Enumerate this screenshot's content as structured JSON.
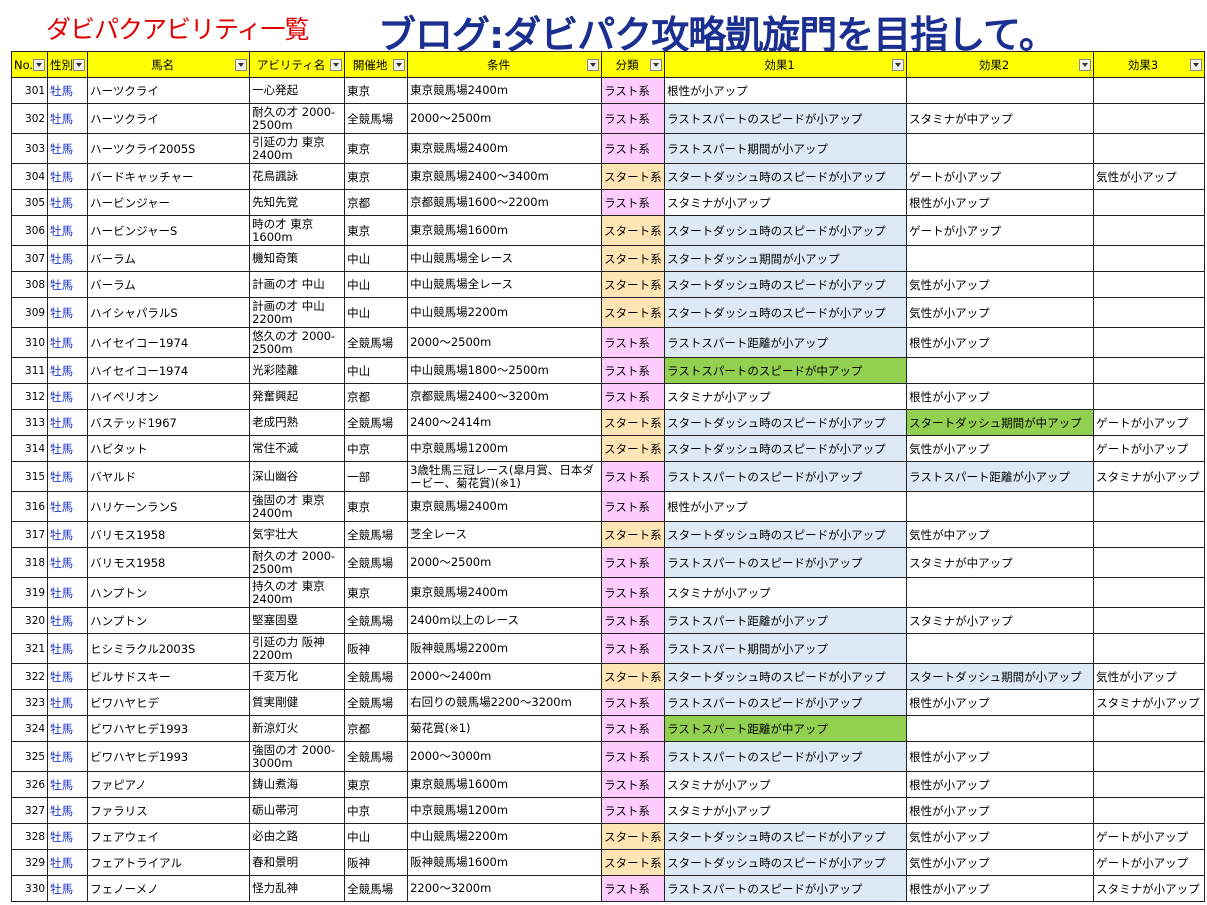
{
  "header": {
    "title_left": "ダビパクアビリティ一覧",
    "title_right": "ブログ:ダビパク攻略凱旋門を目指して。"
  },
  "columns": [
    "No.",
    "性別",
    "馬名",
    "アビリティ名",
    "開催地",
    "条件",
    "分類",
    "効果1",
    "効果2",
    "効果3"
  ],
  "colors": {
    "header_bg": "#ffff00",
    "title_left": "#e00000",
    "title_right": "#1a2f8f",
    "category_last": "#ffccff",
    "category_start": "#ffe4b5",
    "effect_small": "#dde9f5",
    "effect_medium": "#92d050"
  },
  "rows": [
    {
      "no": "301",
      "sex": "牡馬",
      "name": "ハーツクライ",
      "ability": "一心発起",
      "venue": "東京",
      "cond": "東京競馬場2400m",
      "cat": "ラスト系",
      "e1": "根性が小アップ",
      "e2": "",
      "e3": ""
    },
    {
      "no": "302",
      "sex": "牡馬",
      "name": "ハーツクライ",
      "ability": "耐久の才 2000-2500m",
      "venue": "全競馬場",
      "cond": "2000～2500m",
      "cat": "ラスト系",
      "e1": "ラストスパートのスピードが小アップ",
      "e2": "スタミナが中アップ",
      "e3": ""
    },
    {
      "no": "303",
      "sex": "牡馬",
      "name": "ハーツクライ2005S",
      "ability": "引延の力 東京2400m",
      "venue": "東京",
      "cond": "東京競馬場2400m",
      "cat": "ラスト系",
      "e1": "ラストスパート期間が小アップ",
      "e2": "",
      "e3": ""
    },
    {
      "no": "304",
      "sex": "牡馬",
      "name": "バードキャッチャー",
      "ability": "花鳥諷詠",
      "venue": "東京",
      "cond": "東京競馬場2400～3400m",
      "cat": "スタート系",
      "e1": "スタートダッシュ時のスピードが小アップ",
      "e2": "ゲートが小アップ",
      "e3": "気性が小アップ"
    },
    {
      "no": "305",
      "sex": "牡馬",
      "name": "ハービンジャー",
      "ability": "先知先覚",
      "venue": "京都",
      "cond": "京都競馬場1600～2200m",
      "cat": "ラスト系",
      "e1": "スタミナが小アップ",
      "e2": "根性が小アップ",
      "e3": ""
    },
    {
      "no": "306",
      "sex": "牡馬",
      "name": "ハービンジャーS",
      "ability": "時の才 東京1600m",
      "venue": "東京",
      "cond": "東京競馬場1600m",
      "cat": "スタート系",
      "e1": "スタートダッシュ時のスピードが小アップ",
      "e2": "ゲートが小アップ",
      "e3": ""
    },
    {
      "no": "307",
      "sex": "牡馬",
      "name": "バーラム",
      "ability": "機知奇策",
      "venue": "中山",
      "cond": "中山競馬場全レース",
      "cat": "スタート系",
      "e1": "スタートダッシュ期間が小アップ",
      "e2": "",
      "e3": ""
    },
    {
      "no": "308",
      "sex": "牡馬",
      "name": "バーラム",
      "ability": "計画の才 中山",
      "venue": "中山",
      "cond": "中山競馬場全レース",
      "cat": "スタート系",
      "e1": "スタートダッシュ時のスピードが小アップ",
      "e2": "気性が小アップ",
      "e3": ""
    },
    {
      "no": "309",
      "sex": "牡馬",
      "name": "ハイシャパラルS",
      "ability": "計画の才 中山2200m",
      "venue": "中山",
      "cond": "中山競馬場2200m",
      "cat": "スタート系",
      "e1": "スタートダッシュ時のスピードが小アップ",
      "e2": "気性が小アップ",
      "e3": ""
    },
    {
      "no": "310",
      "sex": "牡馬",
      "name": "ハイセイコー1974",
      "ability": "悠久の才 2000-2500m",
      "venue": "全競馬場",
      "cond": "2000～2500m",
      "cat": "ラスト系",
      "e1": "ラストスパート距離が小アップ",
      "e2": "根性が小アップ",
      "e3": ""
    },
    {
      "no": "311",
      "sex": "牡馬",
      "name": "ハイセイコー1974",
      "ability": "光彩陸離",
      "venue": "中山",
      "cond": "中山競馬場1800～2500m",
      "cat": "ラスト系",
      "e1": "ラストスパートのスピードが中アップ",
      "e2": "",
      "e3": ""
    },
    {
      "no": "312",
      "sex": "牡馬",
      "name": "ハイペリオン",
      "ability": "発奮興起",
      "venue": "京都",
      "cond": "京都競馬場2400～3200m",
      "cat": "ラスト系",
      "e1": "スタミナが小アップ",
      "e2": "根性が小アップ",
      "e3": ""
    },
    {
      "no": "313",
      "sex": "牡馬",
      "name": "バステッド1967",
      "ability": "老成円熟",
      "venue": "全競馬場",
      "cond": "2400～2414m",
      "cat": "スタート系",
      "e1": "スタートダッシュ時のスピードが小アップ",
      "e2": "スタートダッシュ期間が中アップ",
      "e3": "ゲートが小アップ"
    },
    {
      "no": "314",
      "sex": "牡馬",
      "name": "ハビタット",
      "ability": "常住不滅",
      "venue": "中京",
      "cond": "中京競馬場1200m",
      "cat": "スタート系",
      "e1": "スタートダッシュ時のスピードが小アップ",
      "e2": "気性が小アップ",
      "e3": "ゲートが小アップ"
    },
    {
      "no": "315",
      "sex": "牡馬",
      "name": "バヤルド",
      "ability": "深山幽谷",
      "venue": "一部",
      "cond": "3歳牡馬三冠レース(皐月賞、日本ダービー、菊花賞)(※1)",
      "cat": "ラスト系",
      "e1": "ラストスパートのスピードが小アップ",
      "e2": "ラストスパート距離が小アップ",
      "e3": "スタミナが小アップ"
    },
    {
      "no": "316",
      "sex": "牡馬",
      "name": "ハリケーンランS",
      "ability": "強固の才 東京2400m",
      "venue": "東京",
      "cond": "東京競馬場2400m",
      "cat": "ラスト系",
      "e1": "根性が小アップ",
      "e2": "",
      "e3": ""
    },
    {
      "no": "317",
      "sex": "牡馬",
      "name": "バリモス1958",
      "ability": "気宇壮大",
      "venue": "全競馬場",
      "cond": "芝全レース",
      "cat": "スタート系",
      "e1": "スタートダッシュ時のスピードが小アップ",
      "e2": "気性が中アップ",
      "e3": ""
    },
    {
      "no": "318",
      "sex": "牡馬",
      "name": "バリモス1958",
      "ability": "耐久の才 2000-2500m",
      "venue": "全競馬場",
      "cond": "2000～2500m",
      "cat": "ラスト系",
      "e1": "ラストスパートのスピードが小アップ",
      "e2": "スタミナが中アップ",
      "e3": ""
    },
    {
      "no": "319",
      "sex": "牡馬",
      "name": "ハンプトン",
      "ability": "持久の才 東京2400m",
      "venue": "東京",
      "cond": "東京競馬場2400m",
      "cat": "ラスト系",
      "e1": "スタミナが小アップ",
      "e2": "",
      "e3": ""
    },
    {
      "no": "320",
      "sex": "牡馬",
      "name": "ハンプトン",
      "ability": "堅塞固塁",
      "venue": "全競馬場",
      "cond": "2400m以上のレース",
      "cat": "ラスト系",
      "e1": "ラストスパート距離が小アップ",
      "e2": "スタミナが小アップ",
      "e3": ""
    },
    {
      "no": "321",
      "sex": "牡馬",
      "name": "ヒシミラクル2003S",
      "ability": "引延の力 阪神2200m",
      "venue": "阪神",
      "cond": "阪神競馬場2200m",
      "cat": "ラスト系",
      "e1": "ラストスパート期間が小アップ",
      "e2": "",
      "e3": ""
    },
    {
      "no": "322",
      "sex": "牡馬",
      "name": "ビルサドスキー",
      "ability": "千変万化",
      "venue": "全競馬場",
      "cond": "2000～2400m",
      "cat": "スタート系",
      "e1": "スタートダッシュ時のスピードが小アップ",
      "e2": "スタートダッシュ期間が小アップ",
      "e3": "気性が小アップ"
    },
    {
      "no": "323",
      "sex": "牡馬",
      "name": "ビワハヤヒデ",
      "ability": "質実剛健",
      "venue": "全競馬場",
      "cond": "右回りの競馬場2200～3200m",
      "cat": "ラスト系",
      "e1": "ラストスパートのスピードが小アップ",
      "e2": "根性が小アップ",
      "e3": "スタミナが小アップ"
    },
    {
      "no": "324",
      "sex": "牡馬",
      "name": "ビワハヤヒデ1993",
      "ability": "新涼灯火",
      "venue": "京都",
      "cond": "菊花賞(※1)",
      "cat": "ラスト系",
      "e1": "ラストスパート距離が中アップ",
      "e2": "",
      "e3": ""
    },
    {
      "no": "325",
      "sex": "牡馬",
      "name": "ビワハヤヒデ1993",
      "ability": "強固の才 2000-3000m",
      "venue": "全競馬場",
      "cond": "2000～3000m",
      "cat": "ラスト系",
      "e1": "ラストスパートのスピードが小アップ",
      "e2": "根性が小アップ",
      "e3": ""
    },
    {
      "no": "326",
      "sex": "牡馬",
      "name": "ファピアノ",
      "ability": "鋳山煮海",
      "venue": "東京",
      "cond": "東京競馬場1600m",
      "cat": "ラスト系",
      "e1": "スタミナが小アップ",
      "e2": "根性が小アップ",
      "e3": ""
    },
    {
      "no": "327",
      "sex": "牡馬",
      "name": "ファラリス",
      "ability": "砺山帯河",
      "venue": "中京",
      "cond": "中京競馬場1200m",
      "cat": "ラスト系",
      "e1": "スタミナが小アップ",
      "e2": "根性が小アップ",
      "e3": ""
    },
    {
      "no": "328",
      "sex": "牡馬",
      "name": "フェアウェイ",
      "ability": "必由之路",
      "venue": "中山",
      "cond": "中山競馬場2200m",
      "cat": "スタート系",
      "e1": "スタートダッシュ時のスピードが小アップ",
      "e2": "気性が小アップ",
      "e3": "ゲートが小アップ"
    },
    {
      "no": "329",
      "sex": "牡馬",
      "name": "フェアトライアル",
      "ability": "春和景明",
      "venue": "阪神",
      "cond": "阪神競馬場1600m",
      "cat": "スタート系",
      "e1": "スタートダッシュ時のスピードが小アップ",
      "e2": "気性が小アップ",
      "e3": "ゲートが小アップ"
    },
    {
      "no": "330",
      "sex": "牡馬",
      "name": "フェノーメノ",
      "ability": "怪力乱神",
      "venue": "全競馬場",
      "cond": "2200～3200m",
      "cat": "ラスト系",
      "e1": "ラストスパートのスピードが小アップ",
      "e2": "根性が小アップ",
      "e3": "スタミナが小アップ"
    }
  ]
}
